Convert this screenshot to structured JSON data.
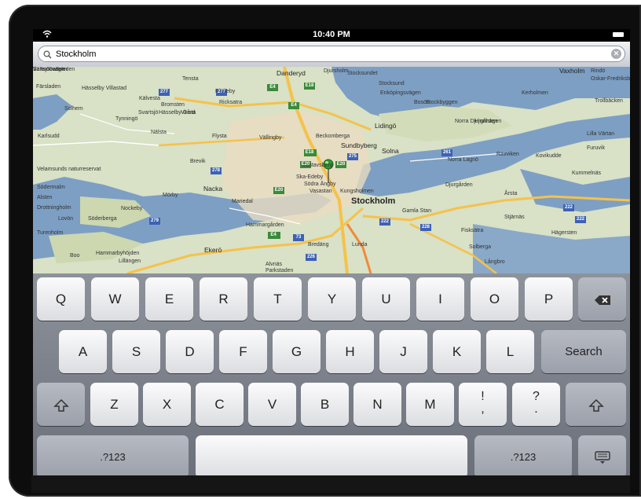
{
  "status": {
    "time": "10:40 PM"
  },
  "search": {
    "value": "Stockholm"
  },
  "map": {
    "labels": [
      {
        "text": "Danderyd",
        "cls": "mid"
      },
      {
        "text": "Djursholm",
        "cls": ""
      },
      {
        "text": "Stocksund",
        "cls": ""
      },
      {
        "text": "Stocksundet",
        "cls": ""
      },
      {
        "text": "Vaxholm",
        "cls": "mid"
      },
      {
        "text": "Rindö",
        "cls": ""
      },
      {
        "text": "Oskar-Fredriksborg",
        "cls": ""
      },
      {
        "text": "Tensta",
        "cls": ""
      },
      {
        "text": "Rinkeby",
        "cls": ""
      },
      {
        "text": "Hässelby Villastad",
        "cls": ""
      },
      {
        "text": "Kälvesta",
        "cls": ""
      },
      {
        "text": "Bromsten",
        "cls": ""
      },
      {
        "text": "Solhem",
        "cls": ""
      },
      {
        "text": "Färsladen",
        "cls": ""
      },
      {
        "text": "Ricksatra",
        "cls": ""
      },
      {
        "text": "Enköpingsvägen",
        "cls": ""
      },
      {
        "text": "Stockbyggen",
        "cls": ""
      },
      {
        "text": "Lidingö",
        "cls": "mid"
      },
      {
        "text": "Bosön",
        "cls": ""
      },
      {
        "text": "Kerholmen",
        "cls": ""
      },
      {
        "text": "Trollbäcken",
        "cls": ""
      },
      {
        "text": "Karlsudd",
        "cls": ""
      },
      {
        "text": "Tynningö",
        "cls": ""
      },
      {
        "text": "Svartsjö",
        "cls": ""
      },
      {
        "text": "Hässelby Gård",
        "cls": ""
      },
      {
        "text": "Vinsta",
        "cls": ""
      },
      {
        "text": "Nälsta",
        "cls": ""
      },
      {
        "text": "Flysta",
        "cls": ""
      },
      {
        "text": "Vällingby",
        "cls": ""
      },
      {
        "text": "Beckomberga",
        "cls": ""
      },
      {
        "text": "Sundbyberg",
        "cls": "mid"
      },
      {
        "text": "Solna",
        "cls": "mid"
      },
      {
        "text": "Norra Djurgården",
        "cls": ""
      },
      {
        "text": "Hjorthagen",
        "cls": ""
      },
      {
        "text": "Lilla Värtan",
        "cls": ""
      },
      {
        "text": "Furuvik",
        "cls": ""
      },
      {
        "text": "Rävviken",
        "cls": ""
      },
      {
        "text": "Kovikudde",
        "cls": ""
      },
      {
        "text": "Norra Lagnö",
        "cls": ""
      },
      {
        "text": "Kummelnäs",
        "cls": ""
      },
      {
        "text": "Velamsunds naturreservat",
        "cls": ""
      },
      {
        "text": "Brevik",
        "cls": ""
      },
      {
        "text": "Gustavsberg",
        "cls": ""
      },
      {
        "text": "Ska-Edeby",
        "cls": ""
      },
      {
        "text": "Södra Ängby",
        "cls": ""
      },
      {
        "text": "Vasastan",
        "cls": ""
      },
      {
        "text": "Kungsholmen",
        "cls": ""
      },
      {
        "text": "Stockholm",
        "cls": "big"
      },
      {
        "text": "Gamla Stan",
        "cls": ""
      },
      {
        "text": "Djurgården",
        "cls": ""
      },
      {
        "text": "Södermalm",
        "cls": ""
      },
      {
        "text": "Nacka",
        "cls": "mid"
      },
      {
        "text": "Mariedal",
        "cls": ""
      },
      {
        "text": "Mörby",
        "cls": ""
      },
      {
        "text": "Nockeby",
        "cls": ""
      },
      {
        "text": "Alsten",
        "cls": ""
      },
      {
        "text": "Drottningholm",
        "cls": ""
      },
      {
        "text": "Lovön",
        "cls": ""
      },
      {
        "text": "Söderberga",
        "cls": ""
      },
      {
        "text": "Turenholm",
        "cls": ""
      },
      {
        "text": "Hammargården",
        "cls": ""
      },
      {
        "text": "Lunda",
        "cls": ""
      },
      {
        "text": "Stjärnäs",
        "cls": ""
      },
      {
        "text": "Hägersten",
        "cls": ""
      },
      {
        "text": "Hammarbyhöjden",
        "cls": ""
      },
      {
        "text": "Boo",
        "cls": ""
      },
      {
        "text": "Lillängen",
        "cls": ""
      },
      {
        "text": "Ekerö",
        "cls": "mid"
      },
      {
        "text": "Alvnäs",
        "cls": ""
      },
      {
        "text": "Parkstaden",
        "cls": ""
      },
      {
        "text": "Bredäng",
        "cls": ""
      },
      {
        "text": "Solberga",
        "cls": ""
      },
      {
        "text": "Långbro",
        "cls": ""
      },
      {
        "text": "Årsta",
        "cls": ""
      },
      {
        "text": "Fisksätra",
        "cls": ""
      },
      {
        "text": "Saltsjöbaden",
        "cls": ""
      },
      {
        "text": "Värmdövägen",
        "cls": ""
      },
      {
        "text": "Saltsjöbadsleden",
        "cls": ""
      }
    ],
    "road_shields": [
      "E4",
      "E18",
      "E4",
      "E18",
      "E20",
      "E20",
      "E4",
      "E20",
      "277",
      "277",
      "278",
      "279",
      "275",
      "261",
      "222",
      "222",
      "222",
      "228",
      "73",
      "226"
    ]
  },
  "keyboard": {
    "row1": [
      "Q",
      "W",
      "E",
      "R",
      "T",
      "Y",
      "U",
      "I",
      "O",
      "P"
    ],
    "backspace_icon": "backspace-icon",
    "row2": [
      "A",
      "S",
      "D",
      "F",
      "G",
      "H",
      "J",
      "K",
      "L"
    ],
    "search_label": "Search",
    "shift_icon": "shift-icon",
    "row3": [
      "Z",
      "X",
      "C",
      "V",
      "B",
      "N",
      "M"
    ],
    "punct1": [
      "!",
      ","
    ],
    "punct2": [
      "?",
      "."
    ],
    "numbers_label": ".?123",
    "hide_keyboard_icon": "keyboard-hide-icon"
  },
  "colors": {
    "water": "#7d9fc4",
    "land": "#d7e0c4",
    "highway": "#f5c24a",
    "shield_green": "#3a8a3a",
    "shield_blue": "#3d61b5"
  }
}
